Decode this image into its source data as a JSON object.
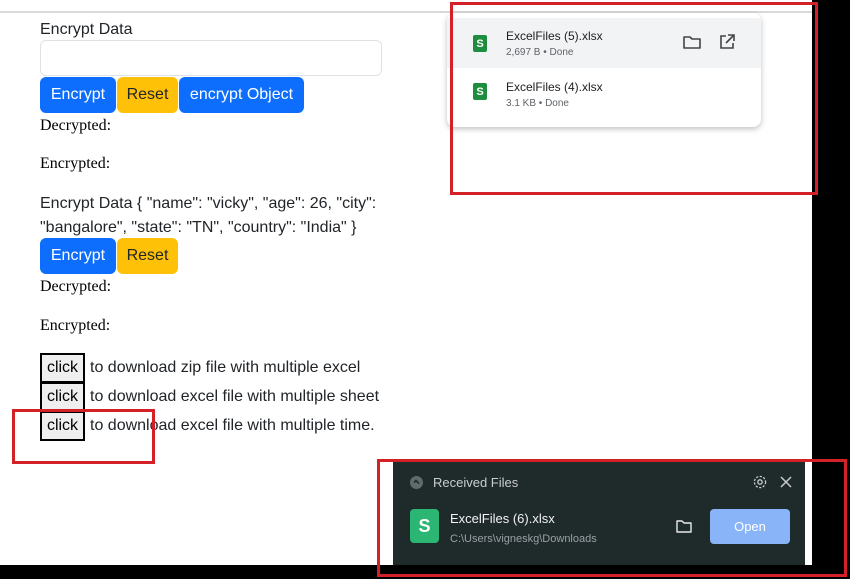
{
  "section1": {
    "title": "Encrypt Data",
    "input_value": "",
    "encrypt_label": "Encrypt",
    "reset_label": "Reset",
    "encrypt_object_label": "encrypt Object",
    "decrypted_label": "Decrypted:",
    "encrypted_label": "Encrypted:"
  },
  "section2": {
    "title_line1": "Encrypt Data { \"name\": \"vicky\", \"age\": 26, \"city\":",
    "title_line2": "\"bangalore\", \"state\": \"TN\", \"country\": \"India\" }",
    "encrypt_label": "Encrypt",
    "reset_label": "Reset",
    "decrypted_label": "Decrypted:",
    "encrypted_label": "Encrypted:"
  },
  "downloads_rows": [
    {
      "button": "click",
      "text": "to download zip file with multiple excel"
    },
    {
      "button": "click",
      "text": "to download excel file with multiple sheet"
    },
    {
      "button": "click",
      "text": "to download excel file with multiple time."
    }
  ],
  "download_popup": {
    "items": [
      {
        "name": "ExcelFiles (5).xlsx",
        "meta": "2,697 B • Done",
        "icon": "S"
      },
      {
        "name": "ExcelFiles (4).xlsx",
        "meta": "3.1 KB • Done",
        "icon": "S"
      }
    ]
  },
  "received_files": {
    "title": "Received Files",
    "file_name": "ExcelFiles (6).xlsx",
    "file_path": "C:\\Users\\vigneskg\\Downloads",
    "file_icon": "S",
    "open_label": "Open"
  },
  "colors": {
    "primary_button": "#0d6efd",
    "warning_button": "#ffc107",
    "annotation_red": "#d42027",
    "toast_background": "#1f2a2a",
    "open_button": "#8ab4f8"
  }
}
